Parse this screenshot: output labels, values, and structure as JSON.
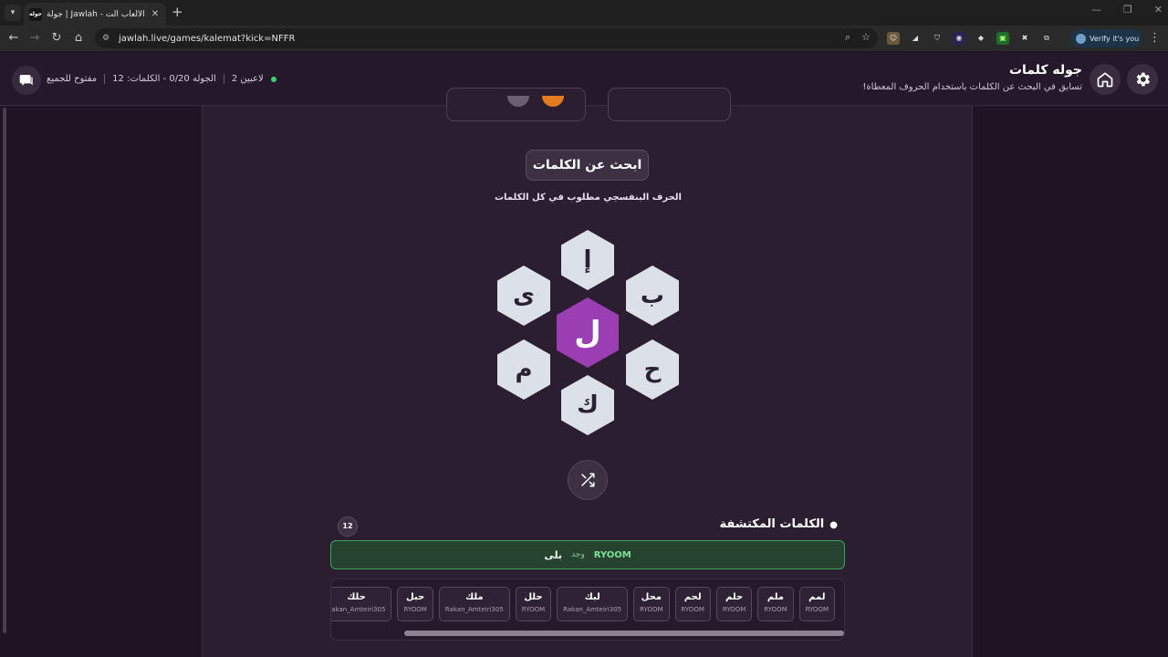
{
  "browser": {
    "tab_title": "جولة | Jawlah - منصة الألعاب الت",
    "tab_favicon_text": "جولة",
    "url": "jawlah.live/games/kalemat?kick=NFFR",
    "verify_label": "Verify it's you"
  },
  "header": {
    "title": "جوله كلمات",
    "subtitle": "تسابق في البحث عن الكلمات باستخدام الحروف المعطاة!",
    "players": "2 لاعبين",
    "round_info": "الجوله 0/20 - الكلمات: 12",
    "access": "مفتوح للجميع",
    "colors": {
      "live": "#3fd16b"
    }
  },
  "game": {
    "heading": "ابحث عن الكلمات",
    "hint": "الحرف البنفسجي مطلوب في كل الكلمات",
    "center_letter": "ل",
    "letters": {
      "top": "إ",
      "top_right": "ب",
      "bottom_right": "ح",
      "bottom": "ك",
      "bottom_left": "م",
      "top_left": "ى"
    },
    "accent_color": "#9b3db3"
  },
  "found": {
    "title": "الكلمات المكتشفة",
    "count": "12",
    "latest": {
      "player": "RYOOM",
      "verb": "وجد",
      "word": "بلى"
    },
    "words": [
      {
        "word": "لمم",
        "player": "RYOOM"
      },
      {
        "word": "ملم",
        "player": "RYOOM"
      },
      {
        "word": "حلم",
        "player": "RYOOM"
      },
      {
        "word": "لحم",
        "player": "RYOOM"
      },
      {
        "word": "محل",
        "player": "RYOOM"
      },
      {
        "word": "لبك",
        "player": "Rakan_Amteiri305"
      },
      {
        "word": "حلل",
        "player": "RYOOM"
      },
      {
        "word": "ملك",
        "player": "Rakan_Amteiri305"
      },
      {
        "word": "حبل",
        "player": "RYOOM"
      },
      {
        "word": "حلك",
        "player": "Rakan_Amteiri305"
      }
    ]
  }
}
